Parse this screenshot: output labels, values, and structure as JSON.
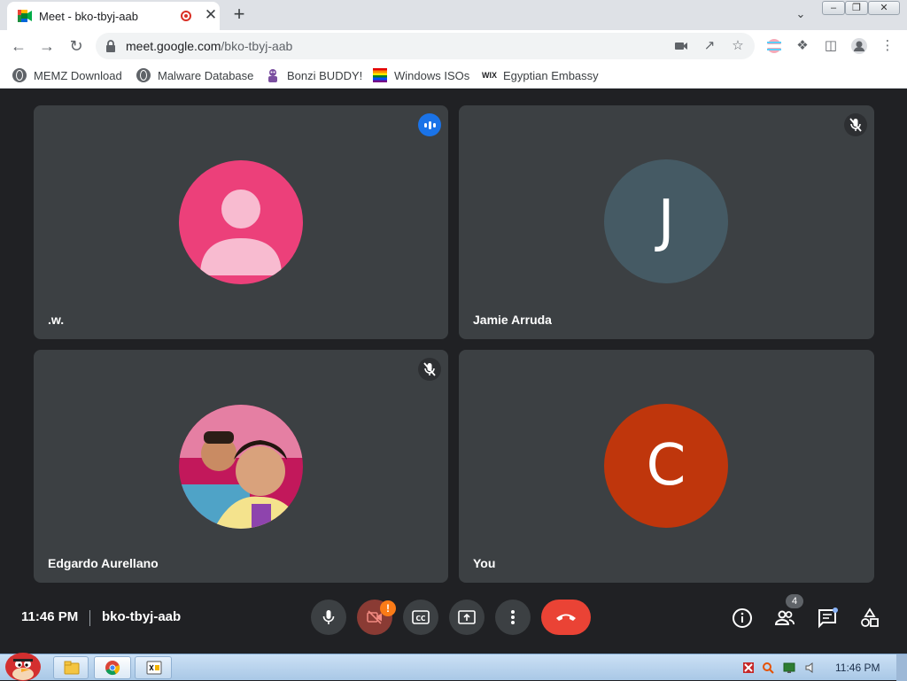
{
  "browser": {
    "tab_title": "Meet - bko-tbyj-aab",
    "new_tab": "+",
    "tab_close": "✕",
    "url_host": "meet.google.com",
    "url_path": "/bko-tbyj-aab",
    "window_controls": [
      "minimize",
      "restore",
      "close"
    ]
  },
  "bookmarks": [
    {
      "label": "MEMZ Download",
      "icon": "globe-icon"
    },
    {
      "label": "Malware Database",
      "icon": "globe-icon"
    },
    {
      "label": "Bonzi BUDDY!",
      "icon": "bonzi-icon"
    },
    {
      "label": "Windows ISOs",
      "icon": "rainbow-flag-icon"
    },
    {
      "label": "Egyptian Embassy",
      "icon": "wix-icon",
      "icon_text": "WIX"
    }
  ],
  "participants": [
    {
      "name": ".w.",
      "avatar": "person-silhouette",
      "avatar_color": "#ec407a",
      "status": "speaking"
    },
    {
      "name": "Jamie Arruda",
      "avatar_letter": "J",
      "avatar_color": "#455a64",
      "status": "muted"
    },
    {
      "name": "Edgardo Aurellano",
      "avatar": "photo",
      "status": "muted"
    },
    {
      "name": "You",
      "avatar_letter": "C",
      "avatar_color": "#bf360c",
      "status": ""
    }
  ],
  "meeting": {
    "time": "11:46 PM",
    "code": "bko-tbyj-aab",
    "camera_warning": "!",
    "people_count": "4"
  },
  "colors": {
    "accent_blue": "#1a73e8",
    "end_call_red": "#ea4335",
    "warning_orange": "#fa7b17"
  },
  "taskbar": {
    "clock": "11:46 PM"
  }
}
